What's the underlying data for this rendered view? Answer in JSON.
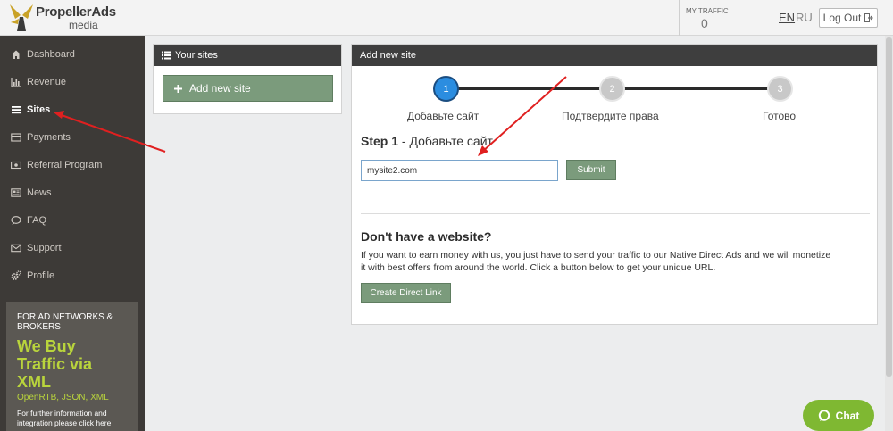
{
  "brand": {
    "name": "PropellerAds",
    "sub": "media"
  },
  "header": {
    "traffic_label": "MY TRAFFIC",
    "traffic_value": "0",
    "lang_en": "EN",
    "lang_ru": "RU",
    "logout_label": "Log Out"
  },
  "sidebar": {
    "items": [
      {
        "label": "Dashboard",
        "icon": "home-icon"
      },
      {
        "label": "Revenue",
        "icon": "bar-chart-icon"
      },
      {
        "label": "Sites",
        "icon": "list-icon",
        "active": true
      },
      {
        "label": "Payments",
        "icon": "credit-card-icon"
      },
      {
        "label": "Referral Program",
        "icon": "money-icon"
      },
      {
        "label": "News",
        "icon": "newspaper-icon"
      },
      {
        "label": "FAQ",
        "icon": "comment-icon"
      },
      {
        "label": "Support",
        "icon": "envelope-icon"
      },
      {
        "label": "Profile",
        "icon": "gears-icon"
      }
    ],
    "promo": {
      "heading": "FOR AD NETWORKS & BROKERS",
      "big": "We Buy Traffic via XML",
      "formats": "OpenRTB, JSON, XML",
      "small": "For further information and integration please click here"
    }
  },
  "your_sites": {
    "title": "Your sites",
    "add_button": "Add new site"
  },
  "add_site": {
    "title": "Add new site",
    "steps": [
      {
        "number": "1",
        "label": "Добавьте сайт"
      },
      {
        "number": "2",
        "label": "Подтвердите права"
      },
      {
        "number": "3",
        "label": "Готово"
      }
    ],
    "step_title_bold": "Step 1",
    "step_title_rest": " - Добавьте сайт",
    "input_value": "mysite2.com",
    "submit_label": "Submit",
    "no_site_title": "Don't have a website?",
    "no_site_text": "If you want to earn money with us, you just have to send your traffic to our Native Direct Ads and we will monetize it with best offers from around the world. Click a button below to get your unique URL.",
    "direct_link_label": "Create Direct Link"
  },
  "chat": {
    "label": "Chat"
  },
  "colors": {
    "sidebar_bg": "#3d3a37",
    "accent_green": "#7b9b7c",
    "step_active": "#2b8de0",
    "promo_text": "#b9d43c",
    "chat_green": "#7fb832",
    "arrow_red": "#e02020"
  }
}
